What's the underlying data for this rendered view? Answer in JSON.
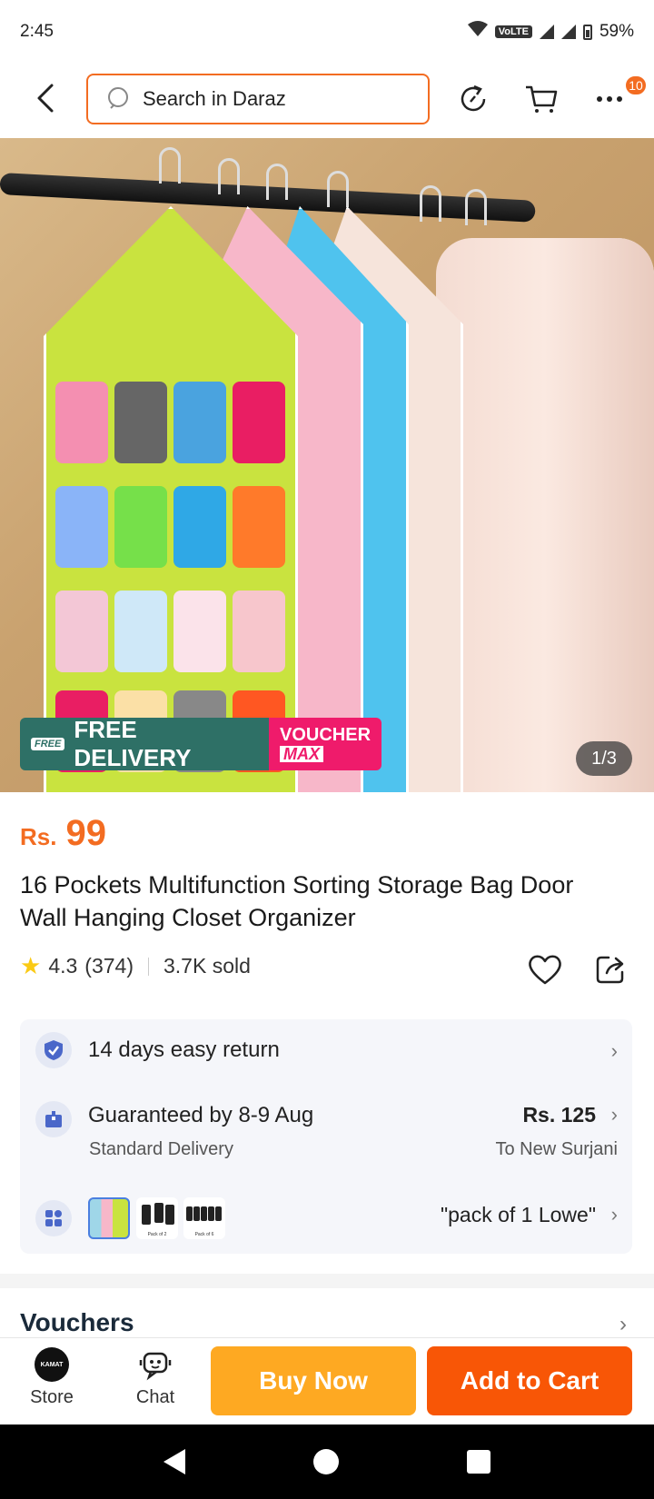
{
  "status_bar": {
    "time": "2:45",
    "network": "VoLTE",
    "battery": "59%"
  },
  "header": {
    "search_placeholder": "Search in Daraz",
    "cart_badge": "10"
  },
  "product_image": {
    "promo_free_tag": "FREE",
    "promo_free_delivery": "FREE DELIVERY",
    "promo_voucher_top": "VOUCHER",
    "promo_voucher_bottom": "MAX",
    "counter": "1/3"
  },
  "product": {
    "currency": "Rs.",
    "price": "99",
    "title": "16 Pockets Multifunction Sorting Storage Bag Door Wall Hanging Closet Organizer",
    "rating": "4.3",
    "reviews": "(374)",
    "sold": "3.7K sold"
  },
  "info_card": {
    "return_policy": "14 days easy return",
    "delivery_guarantee": "Guaranteed by 8-9 Aug",
    "delivery_type": "Standard Delivery",
    "delivery_price": "Rs. 125",
    "delivery_location": "To New Surjani",
    "variant_selected": "\"pack of 1 Lowe\"",
    "variant_thumb_labels": [
      "Pack of 2",
      "Pack of 6"
    ]
  },
  "vouchers": {
    "title": "Vouchers"
  },
  "bottom_bar": {
    "store_logo_text": "KAMAT",
    "store_label": "Store",
    "chat_label": "Chat",
    "buy_now_label": "Buy Now",
    "add_to_cart_label": "Add to Cart"
  },
  "colors": {
    "accent_orange": "#f36c21",
    "buy_now": "#fea922",
    "add_to_cart": "#f85606",
    "free_delivery": "#2e7066",
    "voucher_max": "#ef1b6b"
  },
  "icons": [
    "back-arrow-icon",
    "search-icon",
    "refresh-icon",
    "cart-icon",
    "more-icon",
    "star-icon",
    "heart-icon",
    "share-icon",
    "shield-check-icon",
    "delivery-box-icon",
    "variants-grid-icon",
    "chevron-right-icon",
    "store-logo-icon",
    "chat-bot-icon"
  ]
}
